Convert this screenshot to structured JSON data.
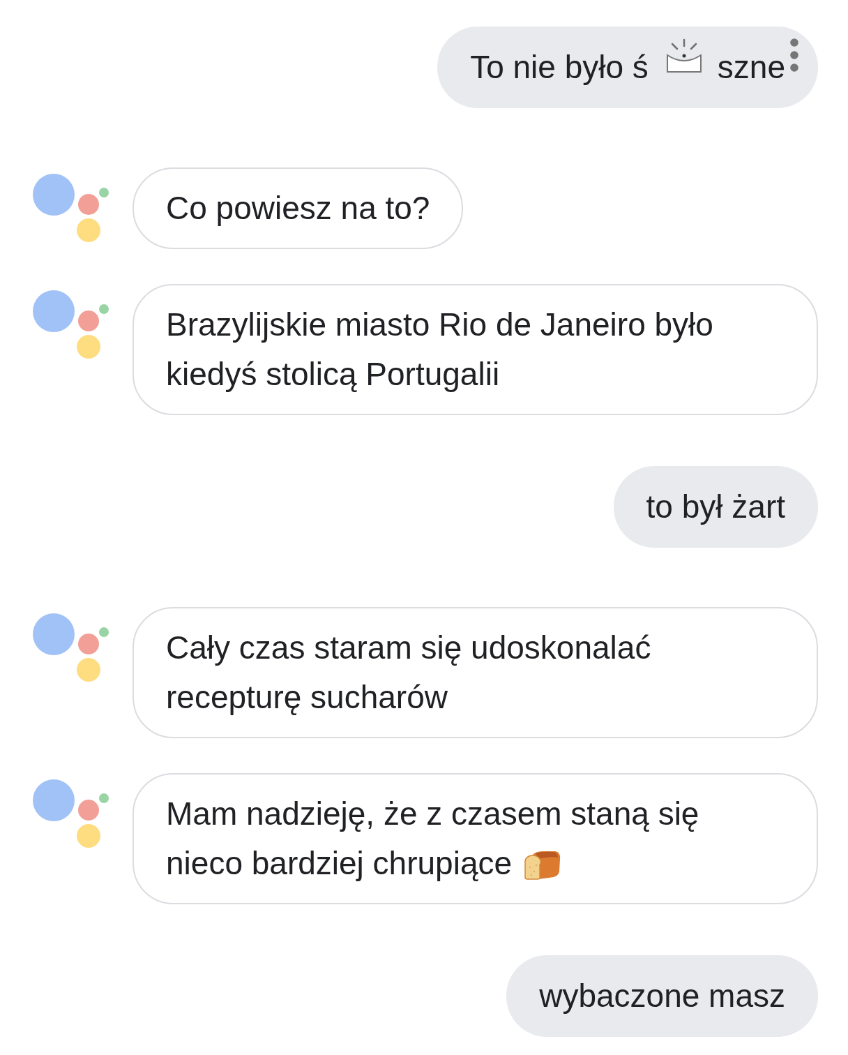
{
  "messages": [
    {
      "kind": "user",
      "lines": [
        "To nie było ś"
      ],
      "sticker": true,
      "after_sticker": "szne",
      "menu_dots": true
    },
    {
      "kind": "assistant",
      "lines": [
        "Co powiesz na to?"
      ]
    },
    {
      "kind": "assistant",
      "lines": [
        "Brazylijskie miasto Rio de Janeiro było",
        "kiedyś stolicą Portugalii"
      ]
    },
    {
      "kind": "user",
      "lines": [
        "to był żart"
      ]
    },
    {
      "kind": "assistant",
      "lines": [
        "Cały czas staram się udoskonalać",
        "recepturę sucharów"
      ]
    },
    {
      "kind": "assistant",
      "lines": [
        "Mam nadzieję, że z czasem staną się",
        "nieco bardziej chrupiące"
      ],
      "trailing_emoji": true
    },
    {
      "kind": "user",
      "lines": [
        "wybaczone masz"
      ]
    }
  ]
}
